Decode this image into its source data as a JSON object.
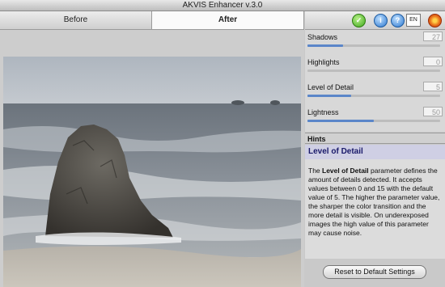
{
  "window": {
    "title": "AKVIS Enhancer v.3.0"
  },
  "tabs": [
    {
      "label": "Before"
    },
    {
      "label": "After"
    }
  ],
  "toolbar": {
    "lang_label": "EN",
    "info_label": "i",
    "help_label": "?"
  },
  "settings": {
    "params": [
      {
        "label": "Shadows",
        "value": "27",
        "fraction": 0.27
      },
      {
        "label": "Highlights",
        "value": "0",
        "fraction": 0.0
      },
      {
        "label": "Level of Detail",
        "value": "5",
        "fraction": 0.33
      },
      {
        "label": "Lightness",
        "value": "50",
        "fraction": 0.5
      }
    ]
  },
  "hints": {
    "header": "Hints",
    "title": "Level of Detail",
    "body_bold": "Level of Detail",
    "body_pre": "The ",
    "body_post": " parameter defines the amount of details detected. It accepts values between 0 and 15 with the default value of 5. The higher the parameter value, the sharper the color transition and the more detail is visible. On underexposed images the high value of this parameter may cause noise."
  },
  "footer": {
    "reset_label": "Reset to Default Settings"
  },
  "colors": {
    "slider_fill": "#5b86c9",
    "hint_title": "#1a1a6a"
  }
}
